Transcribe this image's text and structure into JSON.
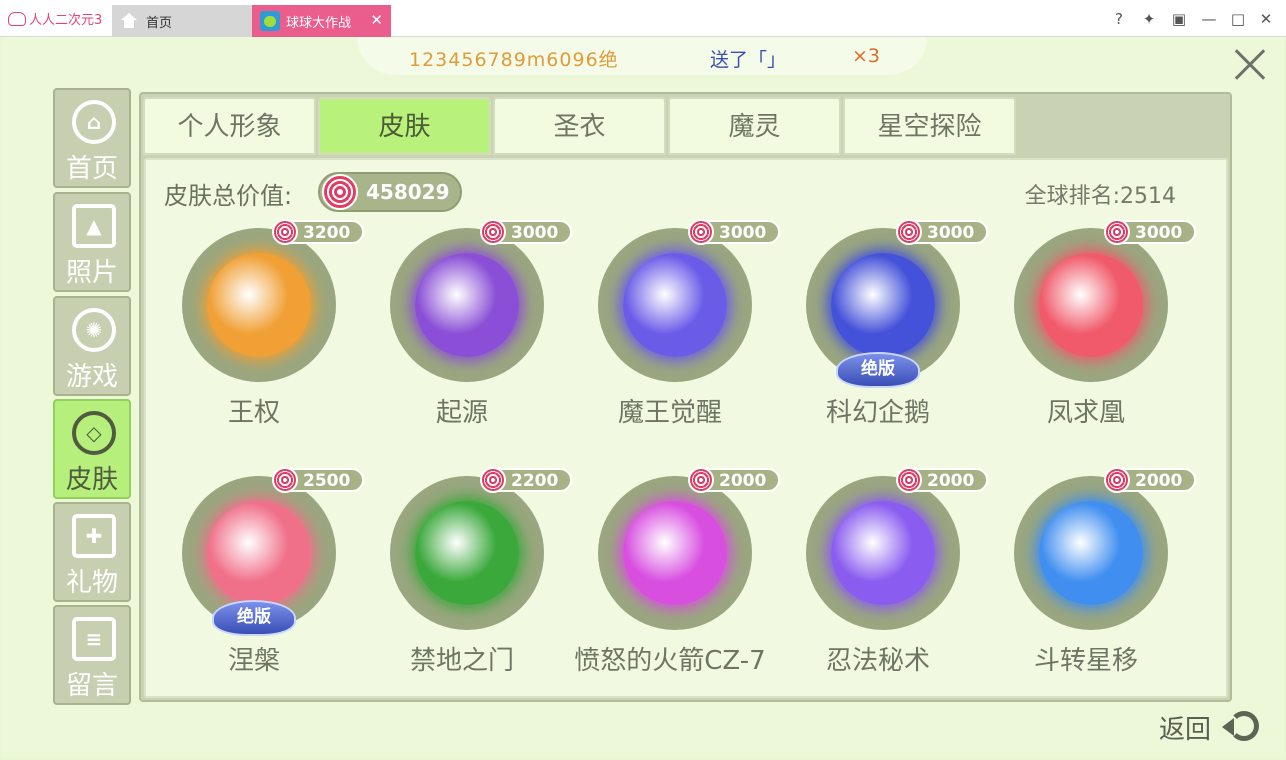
{
  "app": {
    "brand": "人人二次元3"
  },
  "tabs": [
    {
      "label": "首页"
    },
    {
      "label": "球球大作战"
    }
  ],
  "window_controls": [
    "help-icon",
    "pin-icon",
    "restore-icon",
    "minimize-icon",
    "maximize-icon",
    "close-icon"
  ],
  "banner": {
    "user": "123456789m6096绝",
    "message": "送了「」",
    "count": "×3"
  },
  "sidebar": {
    "items": [
      {
        "label": "首页",
        "icon": "home-icon"
      },
      {
        "label": "照片",
        "icon": "photo-icon"
      },
      {
        "label": "游戏",
        "icon": "atom-icon"
      },
      {
        "label": "皮肤",
        "icon": "diamond-icon",
        "active": true
      },
      {
        "label": "礼物",
        "icon": "gift-icon"
      },
      {
        "label": "留言",
        "icon": "message-icon"
      }
    ]
  },
  "top_tabs": [
    {
      "label": "个人形象"
    },
    {
      "label": "皮肤",
      "active": true
    },
    {
      "label": "圣衣"
    },
    {
      "label": "魔灵"
    },
    {
      "label": "星空探险"
    }
  ],
  "summary": {
    "total_label": "皮肤总价值:",
    "total_value": "458029",
    "rank_label": "全球排名:2514"
  },
  "limited_badge": "绝版",
  "skins": [
    {
      "name": "王权",
      "price": "3200",
      "color": "#f0a035"
    },
    {
      "name": "起源",
      "price": "3000",
      "color": "#8a4fd6"
    },
    {
      "name": "魔王觉醒",
      "price": "3000",
      "color": "#6b5ce8"
    },
    {
      "name": "科幻企鹅",
      "price": "3000",
      "color": "#4451d9",
      "limited": true
    },
    {
      "name": "凤求凰",
      "price": "3000",
      "color": "#f05a6a"
    },
    {
      "name": "涅槃",
      "price": "2500",
      "color": "#f0708a",
      "limited": true
    },
    {
      "name": "禁地之门",
      "price": "2200",
      "color": "#3aa83a"
    },
    {
      "name": "愤怒的火箭CZ-7",
      "price": "2000",
      "color": "#d84fe0"
    },
    {
      "name": "忍法秘术",
      "price": "2000",
      "color": "#8a5cf0"
    },
    {
      "name": "斗转星移",
      "price": "2000",
      "color": "#3f8ef0"
    }
  ],
  "back_label": "返回"
}
